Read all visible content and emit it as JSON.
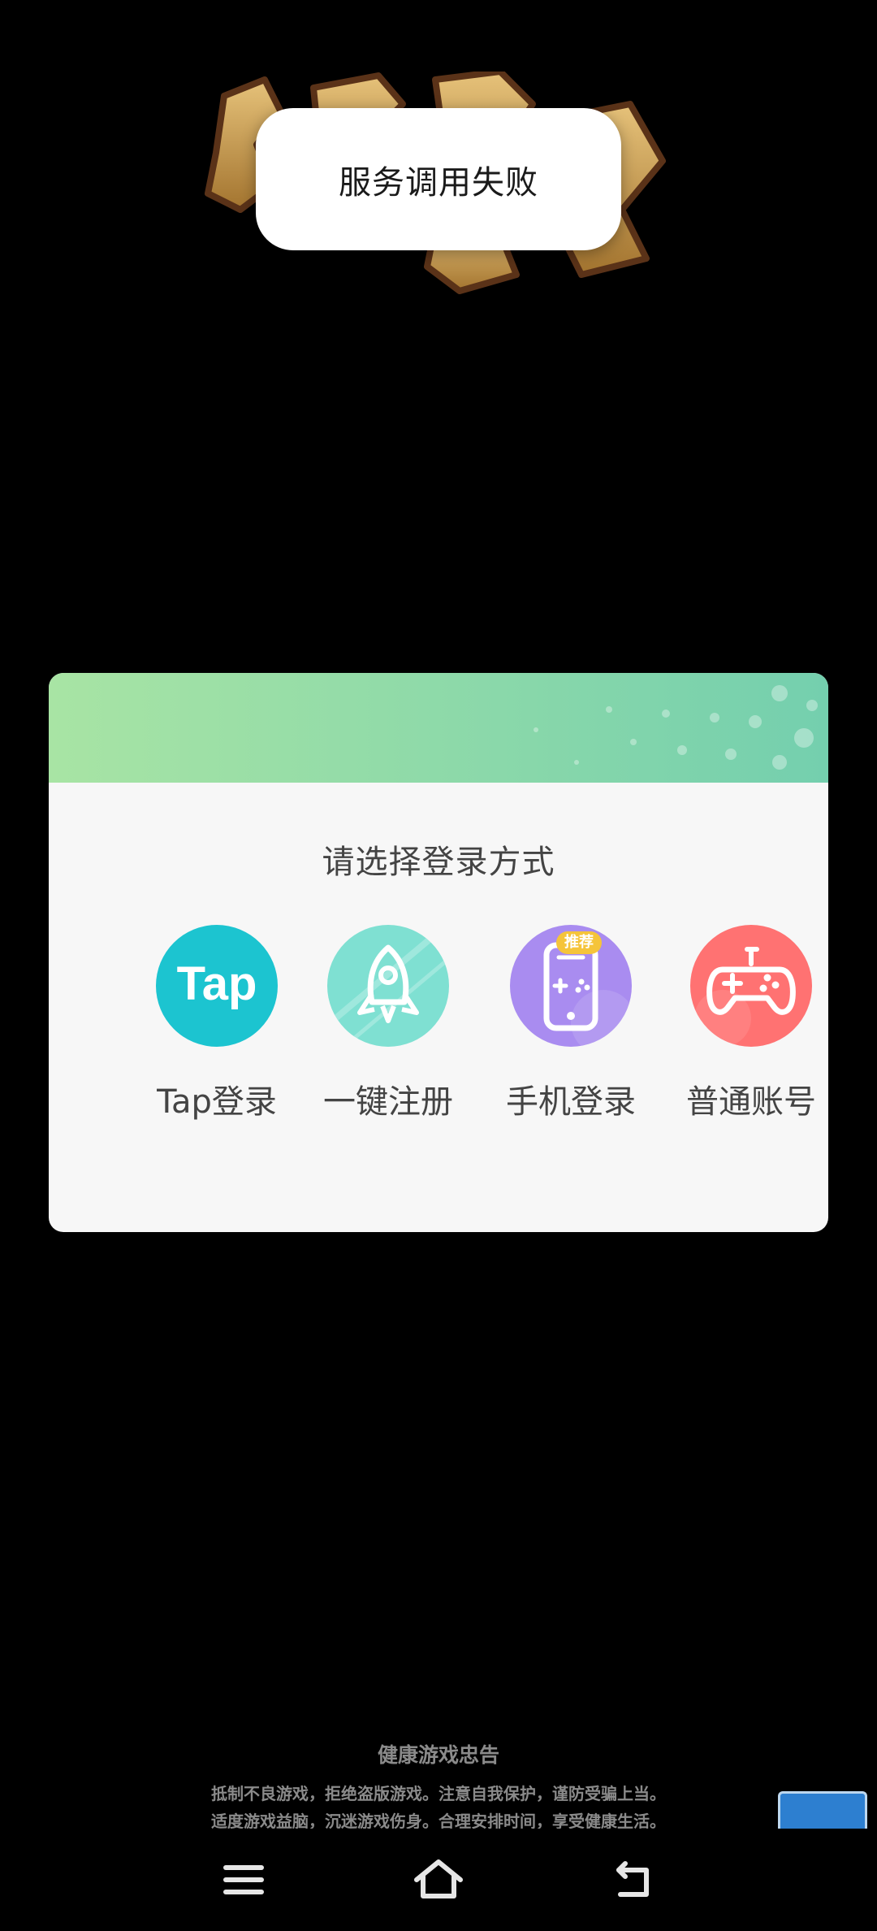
{
  "toast": {
    "message": "服务调用失败"
  },
  "login_dialog": {
    "title": "请选择登录方式",
    "options": [
      {
        "label": "Tap登录",
        "icon": "tap-logo-icon",
        "color": "#1cc4d0"
      },
      {
        "label": "一键注册",
        "icon": "rocket-icon",
        "color": "#7fe0d2"
      },
      {
        "label": "手机登录",
        "icon": "phone-gamepad-icon",
        "color": "#a98cf0",
        "badge": "推荐"
      },
      {
        "label": "普通账号",
        "icon": "gamepad-icon",
        "color": "#ff7272"
      }
    ],
    "tap_logo_text": "Tap"
  },
  "health_notice": {
    "title": "健康游戏忠告",
    "lines": [
      "抵制不良游戏，拒绝盗版游戏。注意自我保护，谨防受骗上当。",
      "适度游戏益脑，沉迷游戏伤身。合理安排时间，享受健康生活。"
    ]
  },
  "navbar": {
    "buttons": [
      "menu-icon",
      "home-icon",
      "back-icon"
    ]
  },
  "colors": {
    "background": "#000000",
    "dialog_bg": "#f7f7f7",
    "banner_start": "#a8e4a4",
    "banner_end": "#74cfae",
    "badge": "#f5c43a"
  }
}
